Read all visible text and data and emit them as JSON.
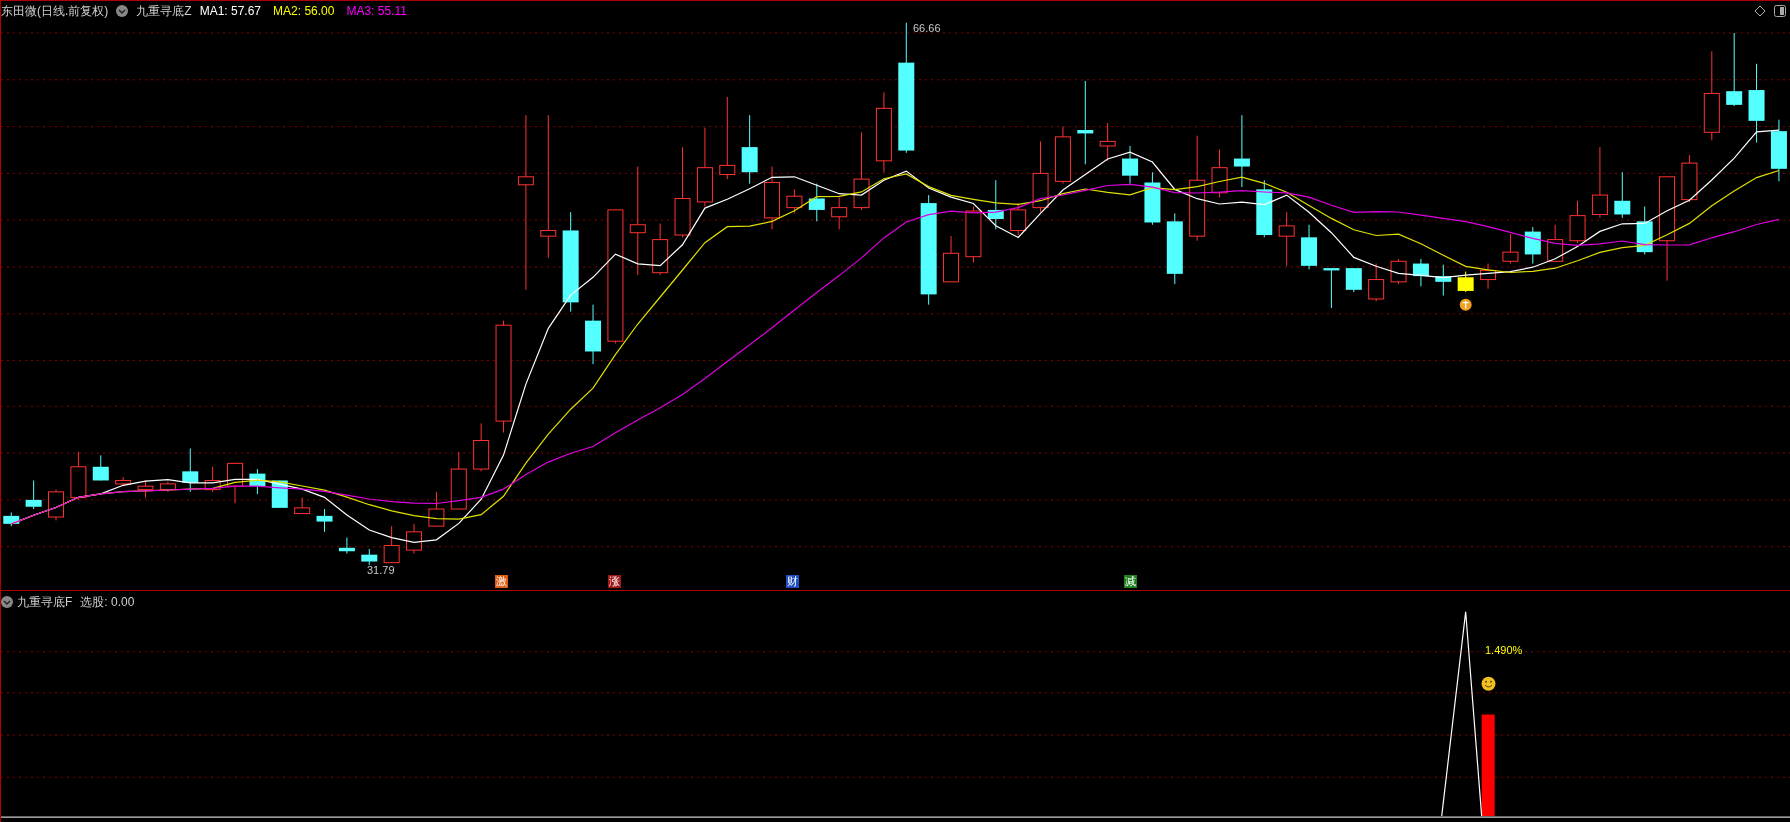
{
  "header": {
    "title": "东田微(日线.前复权)",
    "indicator": "九重寻底Z",
    "averages": [
      {
        "label": "MA1: 57.67",
        "color": "#ffffff"
      },
      {
        "label": "MA2: 56.00",
        "color": "#ffff00"
      },
      {
        "label": "MA3: 55.11",
        "color": "#ff00ff"
      }
    ]
  },
  "price_chart": {
    "high_label": "66.66",
    "low_label": "31.79"
  },
  "signals": [
    {
      "text": "激",
      "color": "#e05a10"
    },
    {
      "text": "涨",
      "color": "#a01818"
    },
    {
      "text": "财",
      "color": "#2050c0"
    },
    {
      "text": "减",
      "color": "#208020"
    }
  ],
  "sub_chart": {
    "indicator": "九重寻底F",
    "value": "选股: 0.00",
    "percent_label": "1.490%"
  }
}
